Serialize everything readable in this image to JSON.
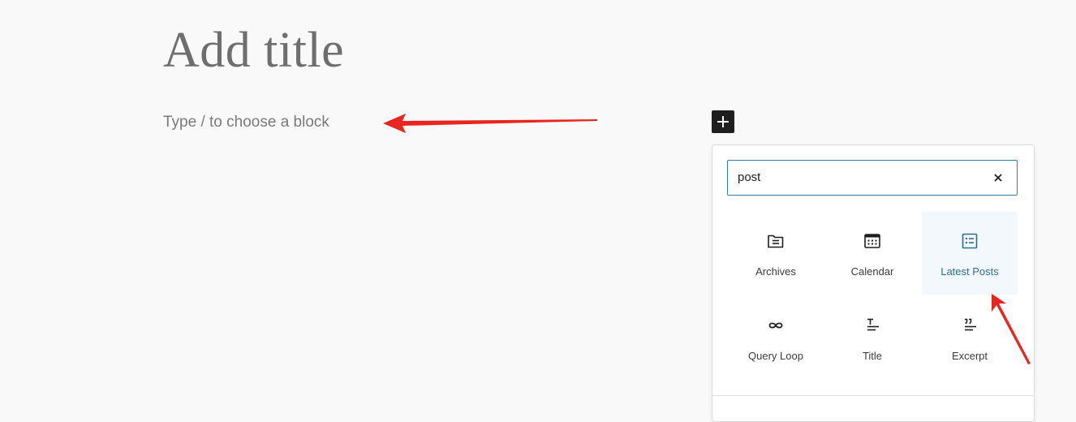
{
  "editor": {
    "title_placeholder": "Add title",
    "block_placeholder": "Type / to choose a block"
  },
  "inserter": {
    "toggle_icon": "plus-icon",
    "search": {
      "value": "post",
      "clear_icon": "close-icon"
    },
    "results": [
      {
        "label": "Archives",
        "icon": "archives-icon",
        "selected": false
      },
      {
        "label": "Calendar",
        "icon": "calendar-icon",
        "selected": false
      },
      {
        "label": "Latest Posts",
        "icon": "latest-posts-icon",
        "selected": true
      },
      {
        "label": "Query Loop",
        "icon": "query-loop-icon",
        "selected": false
      },
      {
        "label": "Title",
        "icon": "post-title-icon",
        "selected": false
      },
      {
        "label": "Excerpt",
        "icon": "post-excerpt-icon",
        "selected": false
      }
    ]
  },
  "colors": {
    "background": "#f9f9f9",
    "accent": "#2f7fa8",
    "selected_label": "#2e6f96",
    "selected_background": "#f2f8fb",
    "annotation_arrow": "#e8251f",
    "toggle_background": "#1e1e1e"
  }
}
